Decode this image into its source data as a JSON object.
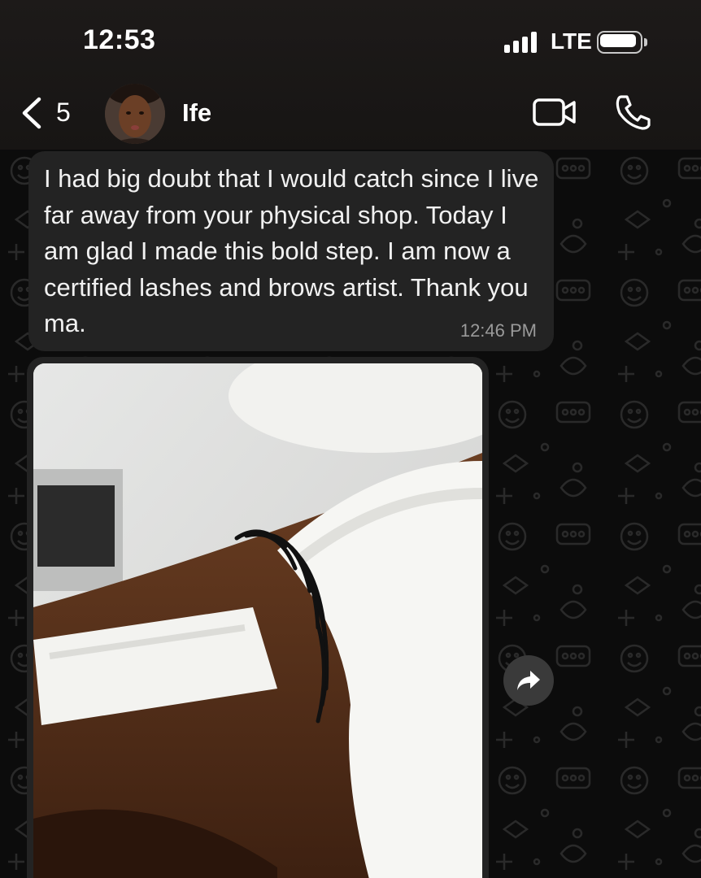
{
  "status_bar": {
    "time": "12:53",
    "network": "LTE"
  },
  "header": {
    "back_count": "5",
    "contact_name": "Ife"
  },
  "messages": [
    {
      "text": "I had big doubt that I would catch since I live far away from your physical shop. Today I am glad I made this bold step. I am now a certified lashes and brows artist. Thank you ma.",
      "time": "12:46 PM"
    }
  ],
  "image_message": {
    "icon": "forward-icon"
  },
  "colors": {
    "bubble": "#232323",
    "header": "#1a1716",
    "background": "#0c0c0c"
  }
}
